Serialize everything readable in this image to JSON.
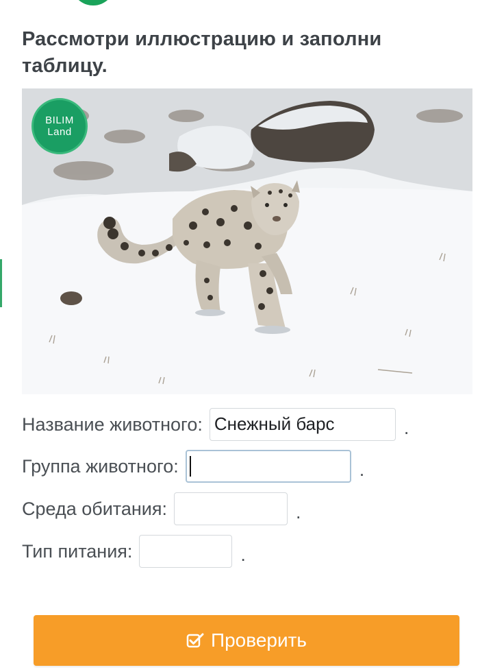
{
  "task": {
    "title": "Рассмотри иллюстрацию и заполни таблицу."
  },
  "illustration": {
    "badge_line1": "BILIM",
    "badge_line2": "Land",
    "subject": "snow-leopard-photo"
  },
  "form": {
    "rows": [
      {
        "label": "Название животного:",
        "value": "Снежный барс",
        "suffix": "."
      },
      {
        "label": "Группа животного:",
        "value": "",
        "suffix": ".",
        "focused": true
      },
      {
        "label": "Среда обитания:",
        "value": "",
        "suffix": "."
      },
      {
        "label": "Тип питания:",
        "value": "",
        "suffix": "."
      }
    ]
  },
  "check_button": {
    "label": "Проверить",
    "icon": "checkbox-check-icon"
  },
  "colors": {
    "accent_green": "#1aa35a",
    "button_orange": "#f79d28",
    "title_text": "#3d4247"
  }
}
